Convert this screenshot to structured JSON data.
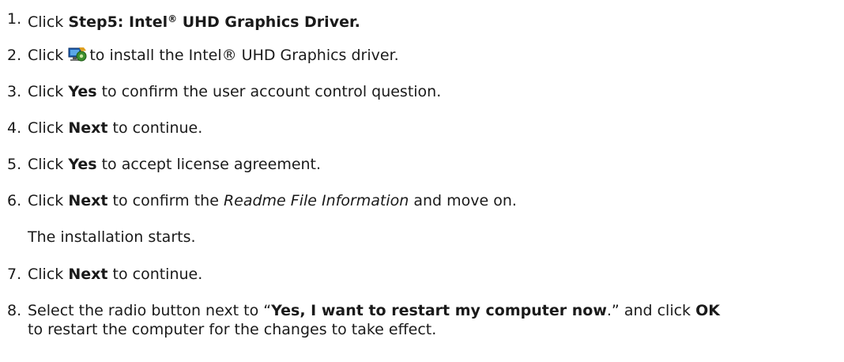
{
  "steps": [
    {
      "num": "1.",
      "pre": "Click ",
      "bold_a": "Step5: Intel",
      "sup": "®",
      "bold_b": " UHD Graphics Driver."
    },
    {
      "num": "2.",
      "pre": "Click ",
      "icon": "setup-install-icon",
      "post": "to install the Intel® UHD Graphics driver."
    },
    {
      "num": "3.",
      "pre": "Click ",
      "bold": "Yes",
      "post": " to confirm the user account control question."
    },
    {
      "num": "4.",
      "pre": "Click ",
      "bold": "Next",
      "post": " to continue."
    },
    {
      "num": "5.",
      "pre": "Click ",
      "bold": "Yes",
      "post": " to accept license agreement."
    },
    {
      "num": "6.",
      "pre": "Click ",
      "bold": "Next",
      "mid": " to confirm the ",
      "italic": "Readme File Information",
      "post": " and move on.",
      "note": "The installation starts."
    },
    {
      "num": "7.",
      "pre": "Click ",
      "bold": "Next",
      "post": " to continue."
    },
    {
      "num": "8.",
      "pre": "Select the radio button next to “",
      "bold": "Yes, I want to restart my computer now",
      "mid": ".” and click ",
      "bold2": "OK",
      "line2": "to restart the computer for the changes to take effect."
    }
  ]
}
